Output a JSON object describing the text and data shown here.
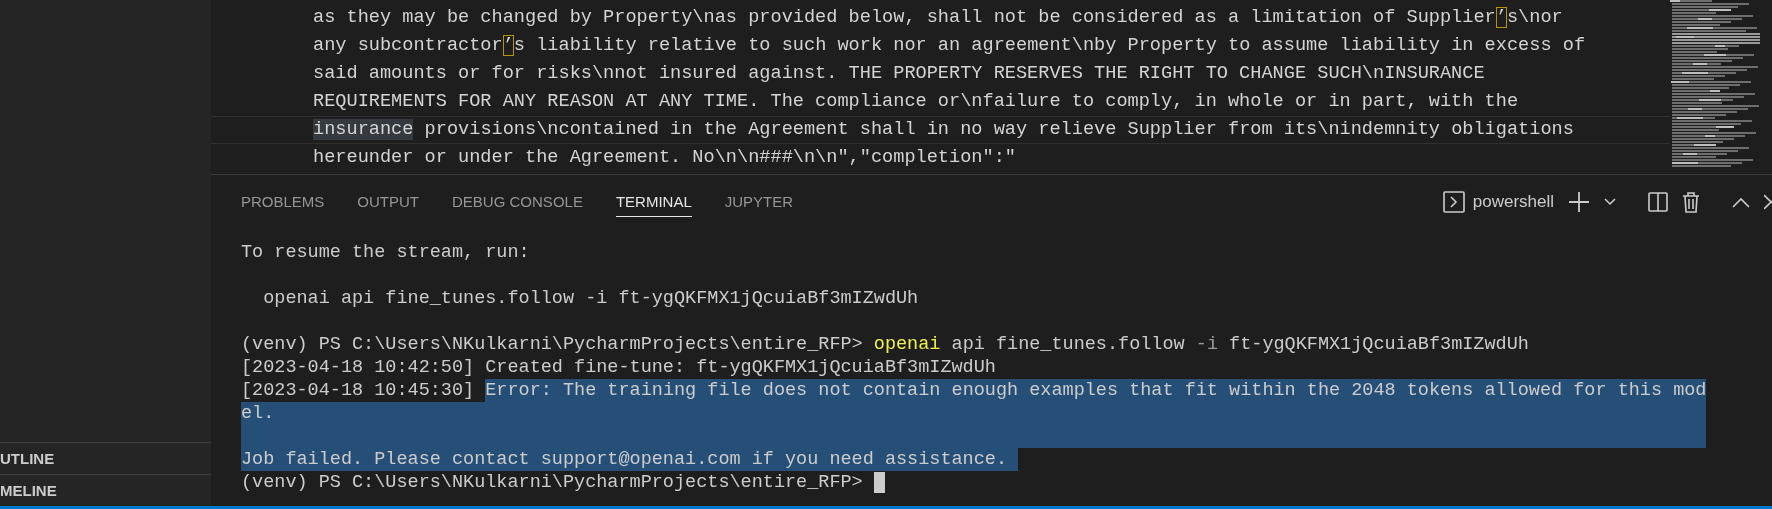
{
  "sidebar": {
    "sections": [
      {
        "title": "UTLINE"
      },
      {
        "title": "MELINE"
      }
    ]
  },
  "editor": {
    "lines": [
      {
        "current": false,
        "parts": [
          {
            "kind": "plain",
            "text": "as they may be changed by Property\\nas provided below, shall not be considered as a limitation of Supplier"
          },
          {
            "kind": "unicode_highlight",
            "text": "’"
          },
          {
            "kind": "plain",
            "text": "s\\nor"
          }
        ]
      },
      {
        "current": false,
        "parts": [
          {
            "kind": "plain",
            "text": "any subcontractor"
          },
          {
            "kind": "unicode_highlight",
            "text": "’"
          },
          {
            "kind": "plain",
            "text": "s liability relative to such work nor an agreement\\nby Property to assume liability in excess of"
          }
        ]
      },
      {
        "current": false,
        "parts": [
          {
            "kind": "plain",
            "text": "said amounts or for risks\\nnot insured against. THE PROPERTY RESERVES THE RIGHT TO CHANGE SUCH\\nINSURANCE"
          }
        ]
      },
      {
        "current": false,
        "parts": [
          {
            "kind": "plain",
            "text": "REQUIREMENTS FOR ANY REASON AT ANY TIME. The compliance or\\nfailure to comply, in whole or in part, with the"
          }
        ]
      },
      {
        "current": true,
        "parts": [
          {
            "kind": "word_highlight",
            "text": "insurance"
          },
          {
            "kind": "plain",
            "text": " provisions\\ncontained in the Agreement shall in no way relieve Supplier from its\\nindemnity obligations"
          }
        ]
      },
      {
        "current": false,
        "parts": [
          {
            "kind": "plain",
            "text": "hereunder or under the Agreement. No\\n\\n###\\n\\n\",\"completion\":\""
          }
        ]
      }
    ]
  },
  "panel": {
    "tabs": [
      {
        "label": "PROBLEMS",
        "selected": false
      },
      {
        "label": "OUTPUT",
        "selected": false
      },
      {
        "label": "DEBUG CONSOLE",
        "selected": false
      },
      {
        "label": "TERMINAL",
        "selected": true
      },
      {
        "label": "JUPYTER",
        "selected": false
      }
    ],
    "shell": "powershell"
  },
  "terminal": {
    "lines": [
      {
        "kind": "text",
        "parts": [
          {
            "kind": "plain",
            "selected": false,
            "text": "To resume the stream, run:"
          }
        ]
      },
      {
        "kind": "blank"
      },
      {
        "kind": "text",
        "parts": [
          {
            "kind": "plain",
            "selected": false,
            "text": "  openai api fine_tunes.follow -i ft-ygQKFMX1jQcuiaBf3mIZwdUh"
          }
        ]
      },
      {
        "kind": "blank"
      },
      {
        "kind": "text",
        "parts": [
          {
            "kind": "plain",
            "selected": false,
            "text": "(venv) PS C:\\Users\\NKulkarni\\PycharmProjects\\entire_RFP> "
          },
          {
            "kind": "command",
            "selected": false,
            "text": "openai"
          },
          {
            "kind": "plain",
            "selected": false,
            "text": " api fine_tunes.follow "
          },
          {
            "kind": "flag",
            "selected": false,
            "text": "-i"
          },
          {
            "kind": "plain",
            "selected": false,
            "text": " ft-ygQKFMX1jQcuiaBf3mIZwdUh"
          }
        ]
      },
      {
        "kind": "text",
        "parts": [
          {
            "kind": "plain",
            "selected": false,
            "text": "[2023-04-18 10:42:50] Created fine-tune: ft-ygQKFMX1jQcuiaBf3mIZwdUh"
          }
        ]
      },
      {
        "kind": "text",
        "parts": [
          {
            "kind": "plain",
            "selected": false,
            "text": "[2023-04-18 10:45:30] "
          },
          {
            "kind": "plain",
            "selected": true,
            "text": "Error: The training file does not contain enough examples that fit within the 2048 tokens allowed for this mod"
          }
        ]
      },
      {
        "kind": "text",
        "parts": [
          {
            "kind": "plain",
            "selected": true,
            "text": "el."
          }
        ]
      },
      {
        "kind": "blank",
        "selected": true
      },
      {
        "kind": "text",
        "parts": [
          {
            "kind": "plain",
            "selected": true,
            "text": "Job failed. Please contact support@openai.com if you need assistance. "
          }
        ]
      },
      {
        "kind": "text",
        "cursor": true,
        "parts": [
          {
            "kind": "plain",
            "selected": false,
            "text": "(venv) PS C:\\Users\\NKulkarni\\PycharmProjects\\entire_RFP> "
          }
        ]
      }
    ]
  }
}
